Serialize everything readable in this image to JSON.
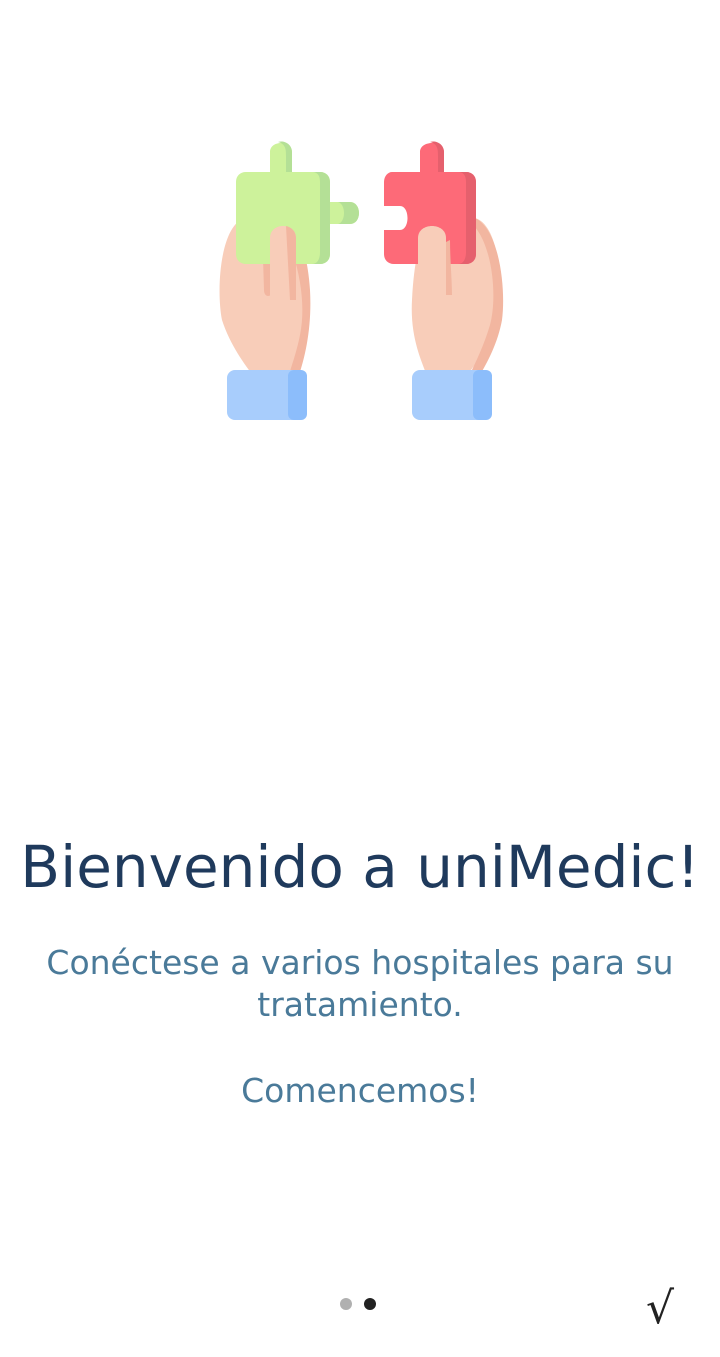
{
  "onboarding": {
    "title": "Bienvenido a uniMedic!",
    "subtitle": "Conéctese a varios hospitales para su tratamiento.",
    "cta": "Comencemos!",
    "illustration_icon": "hands-puzzle-icon",
    "pager": {
      "total": 2,
      "active": 2
    },
    "done_icon": "checkmark-icon",
    "done_symbol": "√"
  },
  "colors": {
    "title": "#1f3a5c",
    "text": "#4a7a99",
    "dot_inactive": "#b0b0b0",
    "dot_active": "#222222"
  }
}
